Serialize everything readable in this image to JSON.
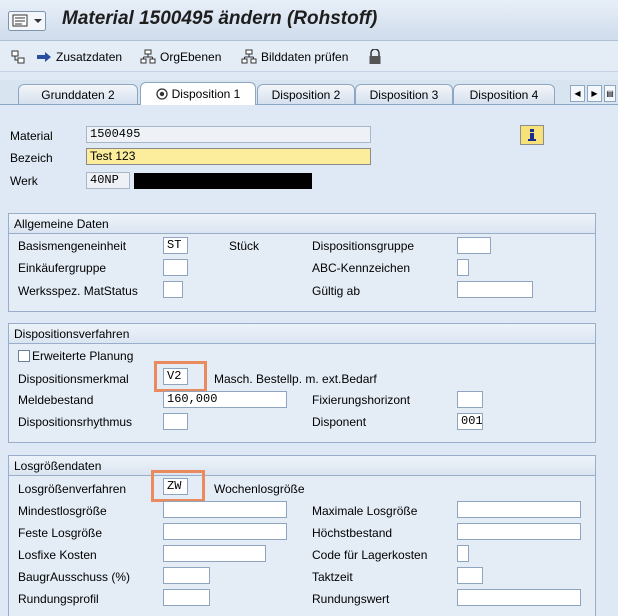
{
  "title": "Material 1500495 ändern (Rohstoff)",
  "toolbar": {
    "zusatzdaten": "Zusatzdaten",
    "orgebenen": "OrgEbenen",
    "bilddaten": "Bilddaten prüfen"
  },
  "tabs": [
    "Grunddaten 2",
    "Disposition 1",
    "Disposition 2",
    "Disposition 3",
    "Disposition 4"
  ],
  "header": {
    "material_label": "Material",
    "material_value": "1500495",
    "bezeich_label": "Bezeich",
    "bezeich_value": "Test 123",
    "werk_label": "Werk",
    "werk_value": "40NP"
  },
  "allgemeine": {
    "title": "Allgemeine Daten",
    "basismenge_label": "Basismengeneinheit",
    "basismenge_value": "ST",
    "basismenge_text": "Stück",
    "einkaeufer_label": "Einkäufergruppe",
    "werksspez_label": "Werksspez. MatStatus",
    "dispogruppe_label": "Dispositionsgruppe",
    "abc_label": "ABC-Kennzeichen",
    "gueltig_label": "Gültig ab"
  },
  "dispoverfahren": {
    "title": "Dispositionsverfahren",
    "erweiterte_label": "Erweiterte Planung",
    "merkmal_label": "Dispositionsmerkmal",
    "merkmal_value": "V2",
    "merkmal_text": "Masch. Bestellp. m. ext.Bedarf",
    "meldebestand_label": "Meldebestand",
    "meldebestand_value": "160,000",
    "rhythmus_label": "Dispositionsrhythmus",
    "fixierung_label": "Fixierungshorizont",
    "disponent_label": "Disponent",
    "disponent_value": "001"
  },
  "losgroesse": {
    "title": "Losgrößendaten",
    "verfahren_label": "Losgrößenverfahren",
    "verfahren_value": "ZW",
    "verfahren_text": "Wochenlosgröße",
    "mindest_label": "Mindestlosgröße",
    "feste_label": "Feste Losgröße",
    "fixe_label": "Losfixe Kosten",
    "baugr_label": "BaugrAusschuss (%)",
    "rundung_label": "Rundungsprofil",
    "maximale_label": "Maximale Losgröße",
    "hoechst_label": "Höchstbestand",
    "code_label": "Code für Lagerkosten",
    "takt_label": "Taktzeit",
    "rundungswert_label": "Rundungswert"
  }
}
